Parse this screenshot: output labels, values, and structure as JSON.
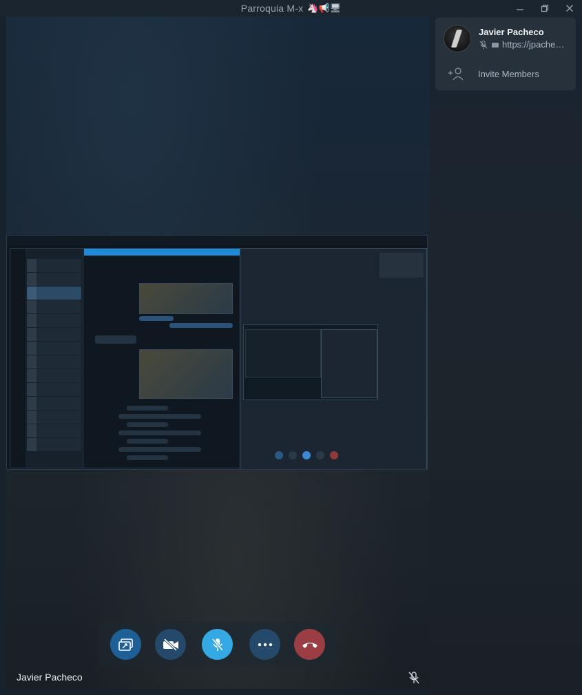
{
  "window": {
    "title": "Parroquia M-x",
    "title_emojis": "🦄📢🖥"
  },
  "members": {
    "name": "Javier Pacheco",
    "url": "https://jpacheco.xyz",
    "invite_label": "Invite Members"
  },
  "footer": {
    "speaker_name": "Javier Pacheco"
  },
  "controls": {
    "share_screen": "share-screen",
    "video": "camera-off",
    "mic": "mic-muted",
    "more": "more",
    "end_call": "end-call"
  },
  "colors": {
    "accent": "#35a9e3",
    "end_call": "#9b3e44",
    "button": "#25496a"
  }
}
